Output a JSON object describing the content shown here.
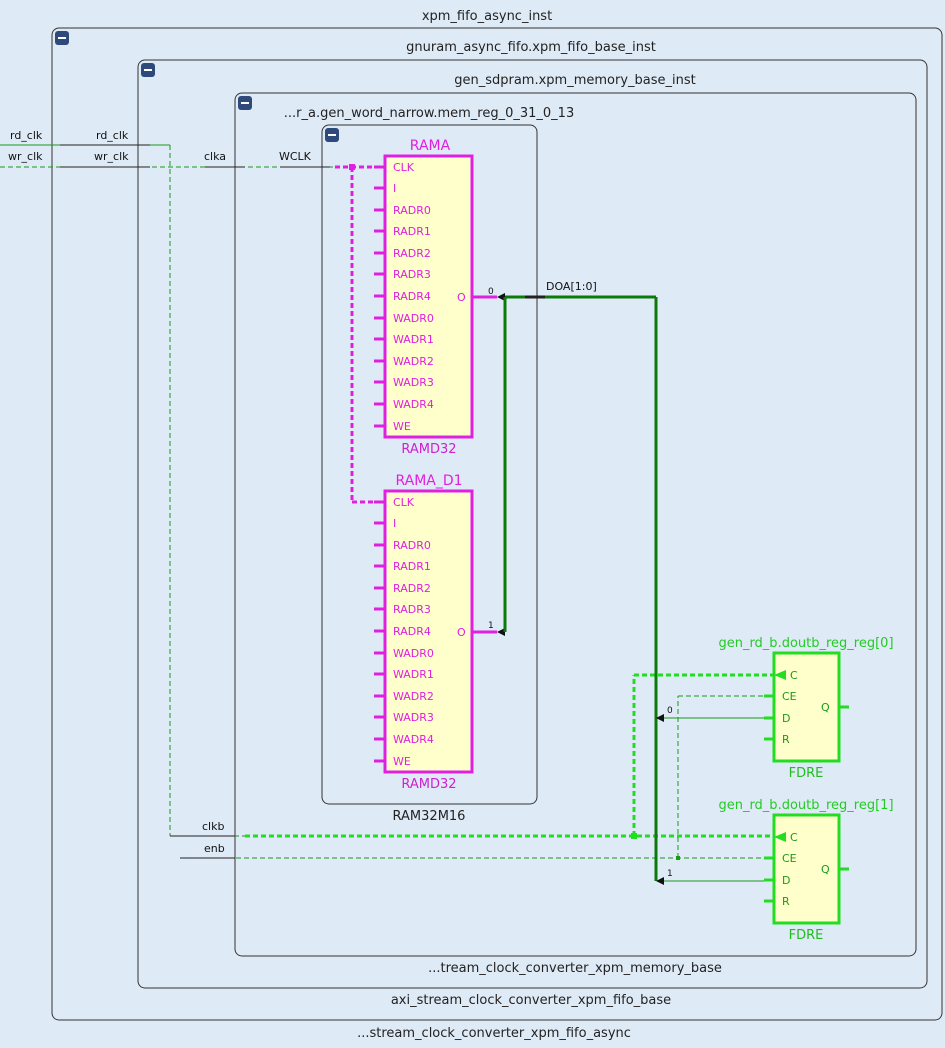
{
  "hierarchy": [
    {
      "name": "xpm_fifo_async_inst",
      "type": "...stream_clock_converter_xpm_fifo_async",
      "collapse_icon": "minus-icon"
    },
    {
      "name": "gnuram_async_fifo.xpm_fifo_base_inst",
      "type": "axi_stream_clock_converter_xpm_fifo_base",
      "collapse_icon": "minus-icon"
    },
    {
      "name": "gen_sdpram.xpm_memory_base_inst",
      "type": "...tream_clock_converter_xpm_memory_base",
      "collapse_icon": "minus-icon"
    },
    {
      "name": "...r_a.gen_word_narrow.mem_reg_0_31_0_13",
      "type": "RAM32M16",
      "collapse_icon": "minus-icon"
    }
  ],
  "ports": {
    "rd_clk_outer": "rd_clk",
    "rd_clk_inner": "rd_clk",
    "wr_clk_outer": "wr_clk",
    "wr_clk_inner": "wr_clk",
    "clka": "clka",
    "wclk": "WCLK",
    "clkb": "clkb",
    "enb": "enb"
  },
  "ram_cells": [
    {
      "name": "RAMA",
      "type": "RAMD32",
      "pins": [
        "CLK",
        "I",
        "RADR0",
        "RADR1",
        "RADR2",
        "RADR3",
        "RADR4",
        "WADR0",
        "WADR1",
        "WADR2",
        "WADR3",
        "WADR4",
        "WE"
      ],
      "out_pin": "O",
      "bit": "0"
    },
    {
      "name": "RAMA_D1",
      "type": "RAMD32",
      "pins": [
        "CLK",
        "I",
        "RADR0",
        "RADR1",
        "RADR2",
        "RADR3",
        "RADR4",
        "WADR0",
        "WADR1",
        "WADR2",
        "WADR3",
        "WADR4",
        "WE"
      ],
      "out_pin": "O",
      "bit": "1"
    }
  ],
  "bus_label": "DOA[1:0]",
  "ff_cells": [
    {
      "name": "gen_rd_b.doutb_reg_reg[0]",
      "type": "FDRE",
      "pins": [
        "C",
        "CE",
        "D",
        "R"
      ],
      "out_pin": "Q",
      "bit": "0"
    },
    {
      "name": "gen_rd_b.doutb_reg_reg[1]",
      "type": "FDRE",
      "pins": [
        "C",
        "CE",
        "D",
        "R"
      ],
      "out_pin": "Q",
      "bit": "1"
    }
  ],
  "colors": {
    "background": "#dfeaf7",
    "frame": "#222222",
    "ram": "#e020e0",
    "ff": "#22dd22",
    "bus": "#0a7a0a",
    "cell_fill": "#ffffcc",
    "collapse_button": "#2e4a7a"
  }
}
